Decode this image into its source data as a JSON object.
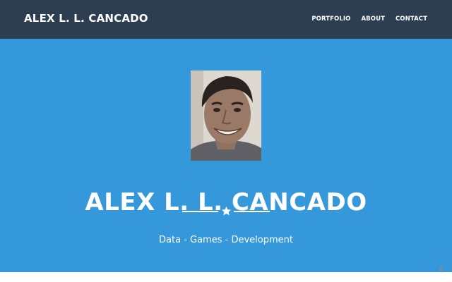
{
  "navbar": {
    "brand": "ALEX L. L. CANCADO",
    "links": [
      "PORTFOLIO",
      "ABOUT",
      "CONTACT"
    ]
  },
  "hero": {
    "name": "ALEX L. L. CANCADO",
    "divider_icon": "star-icon",
    "skills": "Data - Games - Development"
  },
  "colors": {
    "navbar_bg": "#2c3e50",
    "hero_bg": "#3498db",
    "text": "#ffffff"
  },
  "widgets": {
    "corner_icon": "scroll-top-icon"
  }
}
